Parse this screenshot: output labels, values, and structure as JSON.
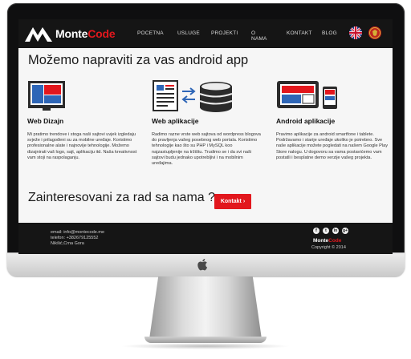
{
  "header": {
    "logo": {
      "part1": "Monte",
      "part2": "Code"
    },
    "nav": [
      "POCETNA",
      "USLUGE",
      "PROJEKTI",
      "O NAMA",
      "KONTAKT",
      "BLOG"
    ]
  },
  "hero": {
    "title": "Možemo napraviti za vas android app"
  },
  "features": [
    {
      "title": "Web Dizajn",
      "icon": "monitor-icon",
      "desc": "Mi pratimo trendove i stoga naši sajtovi uvjek izgledaju svježe i prilagođeni su za mobilne uređaje. Koristimo profesionalne alate i najnovije tehnologije. Možemo dizajnirati vaš logo, sajt, aplikaciju itd. Naša kreativnost vam stoji na raspolaganju."
    },
    {
      "title": "Web aplikacije",
      "icon": "document-database-icon",
      "desc": "Radimo razne vrste web sajtova od wordpress blogova do pravljenja vašeg posebnog web portala. Koristimo tehnologije kao što su PHP i MySQL koo najzastupljenije na tržištu. Trudimo se i da svi naši sajtovi budu jednako upotrebljivi i na mobilnim uređajima."
    },
    {
      "title": "Android aplikacije",
      "icon": "mobile-devices-icon",
      "desc": "Pravimo aplikacije za android smartfone i tablete. Podržavamo i starije uređaje ukoliko je potrebno. Sve naše aplikacije možete pogledati na našem Google Play Store nalogu. U dogovoru sa vama postavićemo vam postatli i besplatne demo verzije vašeg projekta."
    }
  ],
  "cta": {
    "text": "Zainteresovani za rad sa nama ?",
    "button": "Kontakt ›"
  },
  "footer": {
    "email": "email: info@montecode.me",
    "phone": "telefon: +382679125552",
    "address": "Nikšić,Crna Gora",
    "social": [
      "f",
      "t",
      "in",
      "g+"
    ],
    "brand": {
      "part1": "Monte",
      "part2": "Code"
    },
    "copyright": "Copyright © 2014"
  },
  "colors": {
    "brand_red": "#e2171d",
    "header_bg": "#151515",
    "page_bg": "#f6f6f6"
  }
}
